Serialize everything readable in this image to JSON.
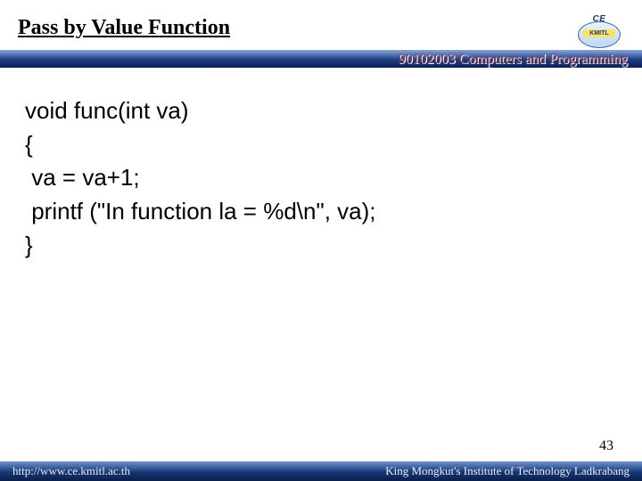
{
  "header": {
    "title": "Pass by Value Function",
    "course": "90102003 Computers and Programming",
    "logo_top": "CE",
    "logo_sub": "KMITL"
  },
  "code": {
    "l1": "void func(int va)",
    "l2": "{",
    "l3": " va = va+1;",
    "l4": " printf (\"In function la = %d\\n\", va);",
    "l5": "}"
  },
  "footer": {
    "url": "http://www.ce.kmitl.ac.th",
    "org": "King Mongkut's Institute of Technology Ladkrabang"
  },
  "page_number": "43"
}
